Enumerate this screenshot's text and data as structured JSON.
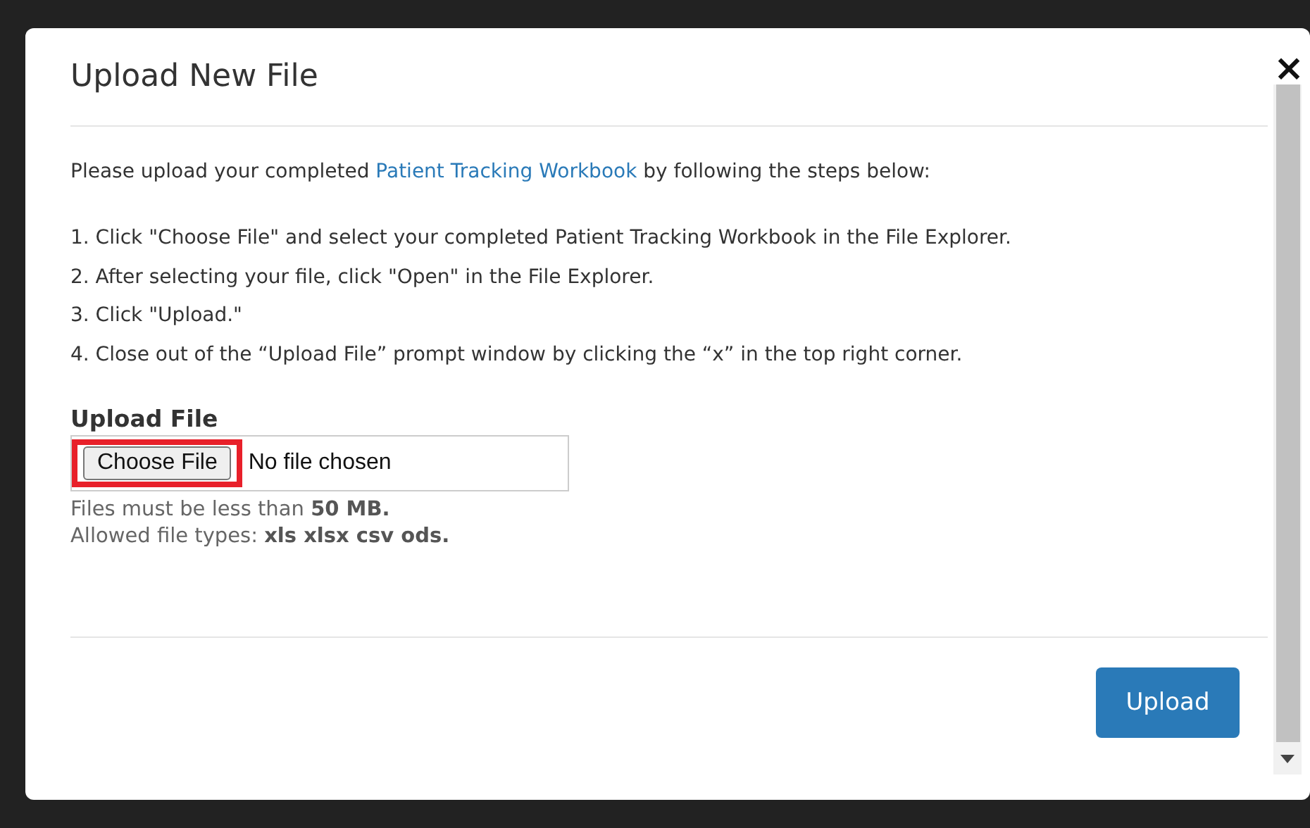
{
  "dialog": {
    "title": "Upload New File",
    "close": "×",
    "intro": {
      "before": "Please upload your completed ",
      "link": "Patient Tracking Workbook",
      "after": " by following the steps below:"
    },
    "steps": [
      "1. Click \"Choose File\" and select your completed Patient Tracking Workbook in the File Explorer.",
      "2. After selecting your file, click \"Open\" in the File Explorer.",
      "3. Click \"Upload.\"",
      "4. Close out of the “Upload File” prompt window by clicking the “x” in the top right corner."
    ],
    "upload": {
      "label": "Upload File",
      "button": "Choose File",
      "status": "No file chosen",
      "highlighted": true,
      "notes": [
        "Files must be less than **50 MB.**",
        "Allowed file types: **xls xlsx csv ods.**"
      ]
    },
    "submit": "Upload"
  }
}
